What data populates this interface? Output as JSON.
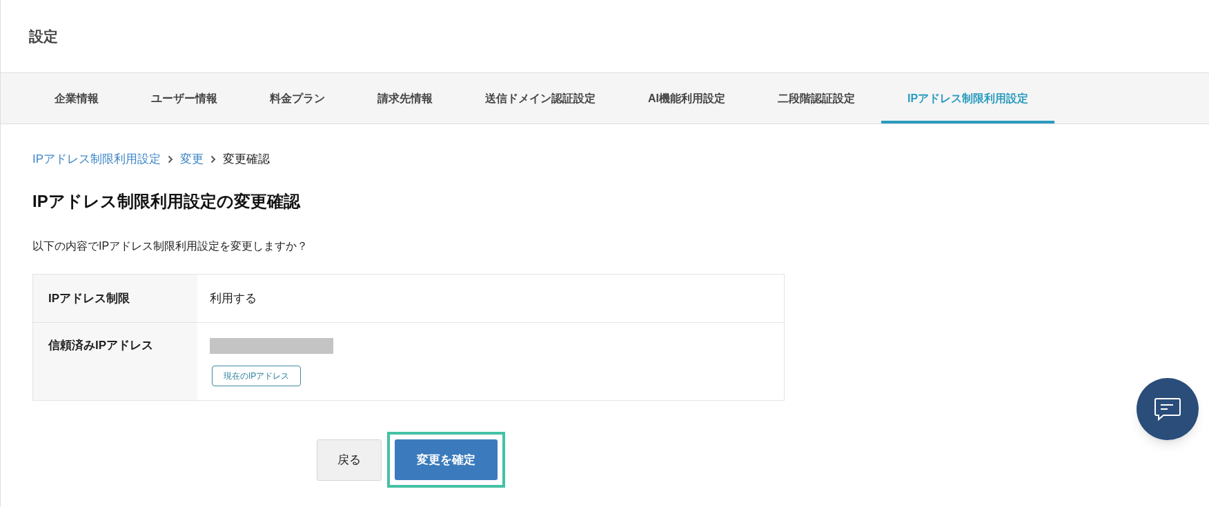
{
  "header": {
    "title": "設定"
  },
  "tabs": [
    {
      "label": "企業情報",
      "selected": false
    },
    {
      "label": "ユーザー情報",
      "selected": false
    },
    {
      "label": "料金プラン",
      "selected": false
    },
    {
      "label": "請求先情報",
      "selected": false
    },
    {
      "label": "送信ドメイン認証設定",
      "selected": false
    },
    {
      "label": "AI機能利用設定",
      "selected": false
    },
    {
      "label": "二段階認証設定",
      "selected": false
    },
    {
      "label": "IPアドレス制限利用設定",
      "selected": true
    }
  ],
  "breadcrumb": [
    {
      "label": "IPアドレス制限利用設定",
      "kind": "link"
    },
    {
      "label": "変更",
      "kind": "link"
    },
    {
      "label": "変更確認",
      "kind": "current"
    }
  ],
  "heading": "IPアドレス制限利用設定の変更確認",
  "description": "以下の内容でIPアドレス制限利用設定を変更しますか？",
  "table": {
    "rows": [
      {
        "label": "IPアドレス制限",
        "value": "利用する"
      },
      {
        "label": "信頼済みIPアドレス",
        "kind": "redacted",
        "button": "現在のIPアドレス"
      }
    ]
  },
  "buttons": {
    "back": "戻る",
    "confirm": "変更を確定",
    "confirm_highlighted": true
  }
}
